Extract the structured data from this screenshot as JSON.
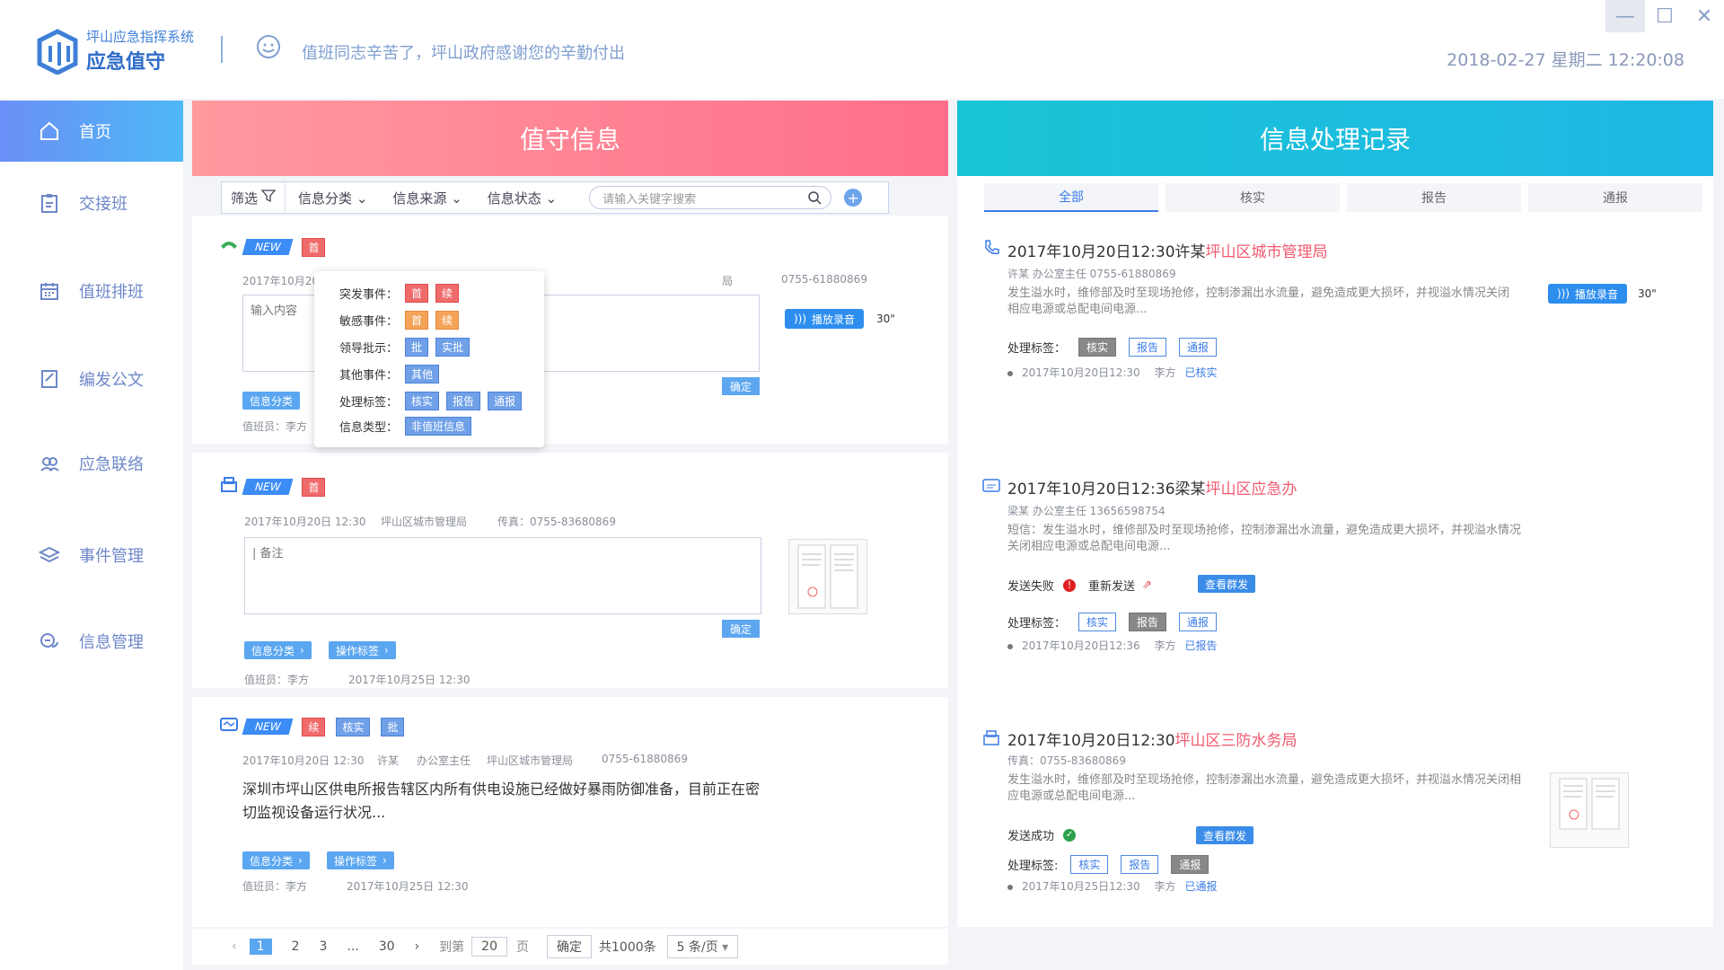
{
  "header": {
    "system_name": "坪山应急指挥系统",
    "app_name": "应急值守",
    "greeting": "值班同志辛苦了，坪山政府感谢您的辛勤付出",
    "datetime": "2018-02-27  星期二  12:20:08"
  },
  "window": {
    "minimize": "—",
    "maximize": "☐",
    "close": "✕"
  },
  "sidebar": {
    "items": [
      {
        "label": "首页",
        "icon": "home-icon"
      },
      {
        "label": "交接班",
        "icon": "clipboard-icon"
      },
      {
        "label": "值班排班",
        "icon": "calendar-icon"
      },
      {
        "label": "编发公文",
        "icon": "edit-document-icon"
      },
      {
        "label": "应急联络",
        "icon": "contacts-icon"
      },
      {
        "label": "事件管理",
        "icon": "layers-icon"
      },
      {
        "label": "信息管理",
        "icon": "chat-icon"
      }
    ]
  },
  "left_panel": {
    "title": "值守信息",
    "filter": {
      "label": "筛选",
      "category": "信息分类",
      "source": "信息来源",
      "status": "信息状态",
      "search_placeholder": "请输入关键字搜索"
    },
    "cards": [
      {
        "new": "NEW",
        "tags": [
          "首"
        ],
        "meta": "2017年10月20",
        "meta2": "局",
        "phone": "0755-61880869",
        "input_placeholder": "输入内容",
        "ok": "确定",
        "play": "播放录音",
        "duration": "30\"",
        "btn_category": "信息分类",
        "staff": "值班员：李方"
      },
      {
        "new": "NEW",
        "tags": [
          "首"
        ],
        "date": "2017年10月20日  12:30",
        "org": "坪山区城市管理局",
        "fax": "传真：0755-83680869",
        "input_placeholder": "| 备注",
        "ok": "确定",
        "btn_category": "信息分类",
        "btn_tag": "操作标签",
        "staff": "值班员：李方",
        "staff_time": "2017年10月25日   12:30"
      },
      {
        "new": "NEW",
        "tags": [
          "续",
          "核实",
          "批"
        ],
        "date": "2017年10月20日  12:30",
        "person": "许某",
        "role": "办公室主任",
        "org": "坪山区城市管理局",
        "phone": "0755-61880869",
        "content": "深圳市坪山区供电所报告辖区内所有供电设施已经做好暴雨防御准备，目前正在密切监视设备运行状况...",
        "btn_category": "信息分类",
        "btn_tag": "操作标签",
        "staff": "值班员：李方",
        "staff_time": "2017年10月25日   12:30"
      }
    ],
    "popup": {
      "rows": [
        {
          "label": "突发事件：",
          "tags": [
            "首",
            "续"
          ]
        },
        {
          "label": "敏感事件：",
          "tags": [
            "首",
            "续"
          ]
        },
        {
          "label": "领导批示：",
          "tags": [
            "批",
            "实批"
          ]
        },
        {
          "label": "其他事件：",
          "tags": [
            "其他"
          ]
        },
        {
          "label": "处理标签：",
          "tags": [
            "核实",
            "报告",
            "通报"
          ]
        },
        {
          "label": "信息类型：",
          "tags": [
            "非值班信息"
          ]
        }
      ]
    }
  },
  "pager": {
    "pages": [
      "1",
      "2",
      "3",
      "...",
      "30"
    ],
    "goto": "到第",
    "page_input": "20",
    "page_unit": "页",
    "confirm": "确定",
    "total": "共1000条",
    "per_page": "5 条/页"
  },
  "right_panel": {
    "title": "信息处理记录",
    "tabs": [
      "全部",
      "核实",
      "报告",
      "通报"
    ],
    "records": [
      {
        "title_prefix": "2017年10月20日12:30许某",
        "title_org": "坪山区城市管理局",
        "sub": "许某   办公室主任   0755-61880869",
        "desc": "发生溢水时，维修部及时至现场抢修，控制渗漏出水流量，避免造成更大损坏，并视溢水情况关闭相应电源或总配电间电源...",
        "play": "播放录音",
        "duration": "30\"",
        "tag_label": "处理标签：",
        "tags": [
          "核实",
          "报告",
          "通报"
        ],
        "foot_time": "2017年10月20日12:30",
        "foot_person": "李方",
        "foot_status": "已核实"
      },
      {
        "title_prefix": "2017年10月20日12:36梁某",
        "title_org": "坪山区应急办",
        "sub": "梁某   办公室主任   13656598754",
        "desc": "短信：发生溢水时，维修部及时至现场抢修，控制渗漏出水流量，避免造成更大损坏，并视溢水情况关闭相应电源或总配电间电源...",
        "send_status": "发送失败",
        "resend": "重新发送",
        "group_btn": "查看群发",
        "tag_label": "处理标签：",
        "tags": [
          "核实",
          "报告",
          "通报"
        ],
        "foot_time": "2017年10月20日12:36",
        "foot_person": "李方",
        "foot_status": "已报告"
      },
      {
        "title_prefix": "2017年10月20日12:30",
        "title_org": "坪山区三防水务局",
        "sub": "传真：0755-83680869",
        "desc": "发生溢水时，维修部及时至现场抢修，控制渗漏出水流量，避免造成更大损坏，并视溢水情况关闭相应电源或总配电间电源...",
        "send_status": "发送成功",
        "group_btn": "查看群发",
        "tag_label": "处理标签:",
        "tags": [
          "核实",
          "报告",
          "通报"
        ],
        "foot_time": "2017年10月25日12:30",
        "foot_person": "李方",
        "foot_status": "已通报"
      }
    ]
  }
}
